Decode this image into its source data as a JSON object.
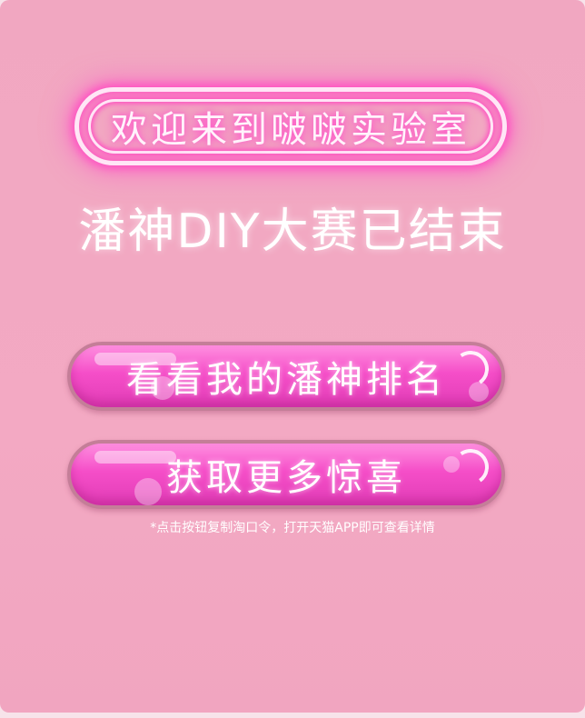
{
  "welcome": {
    "text": "欢迎来到啵啵实验室"
  },
  "headline": {
    "text": "潘神DIY大赛已结束"
  },
  "buttons": {
    "ranking_label": "看看我的潘神排名",
    "surprise_label": "获取更多惊喜"
  },
  "note": {
    "text": "*点击按钮复制淘口令，打开天猫APP即可查看详情"
  },
  "colors": {
    "background": "#f2a8c2",
    "button_pink": "#f54ec8",
    "neon_glow": "#ff4fc2",
    "text": "#ffffff"
  }
}
